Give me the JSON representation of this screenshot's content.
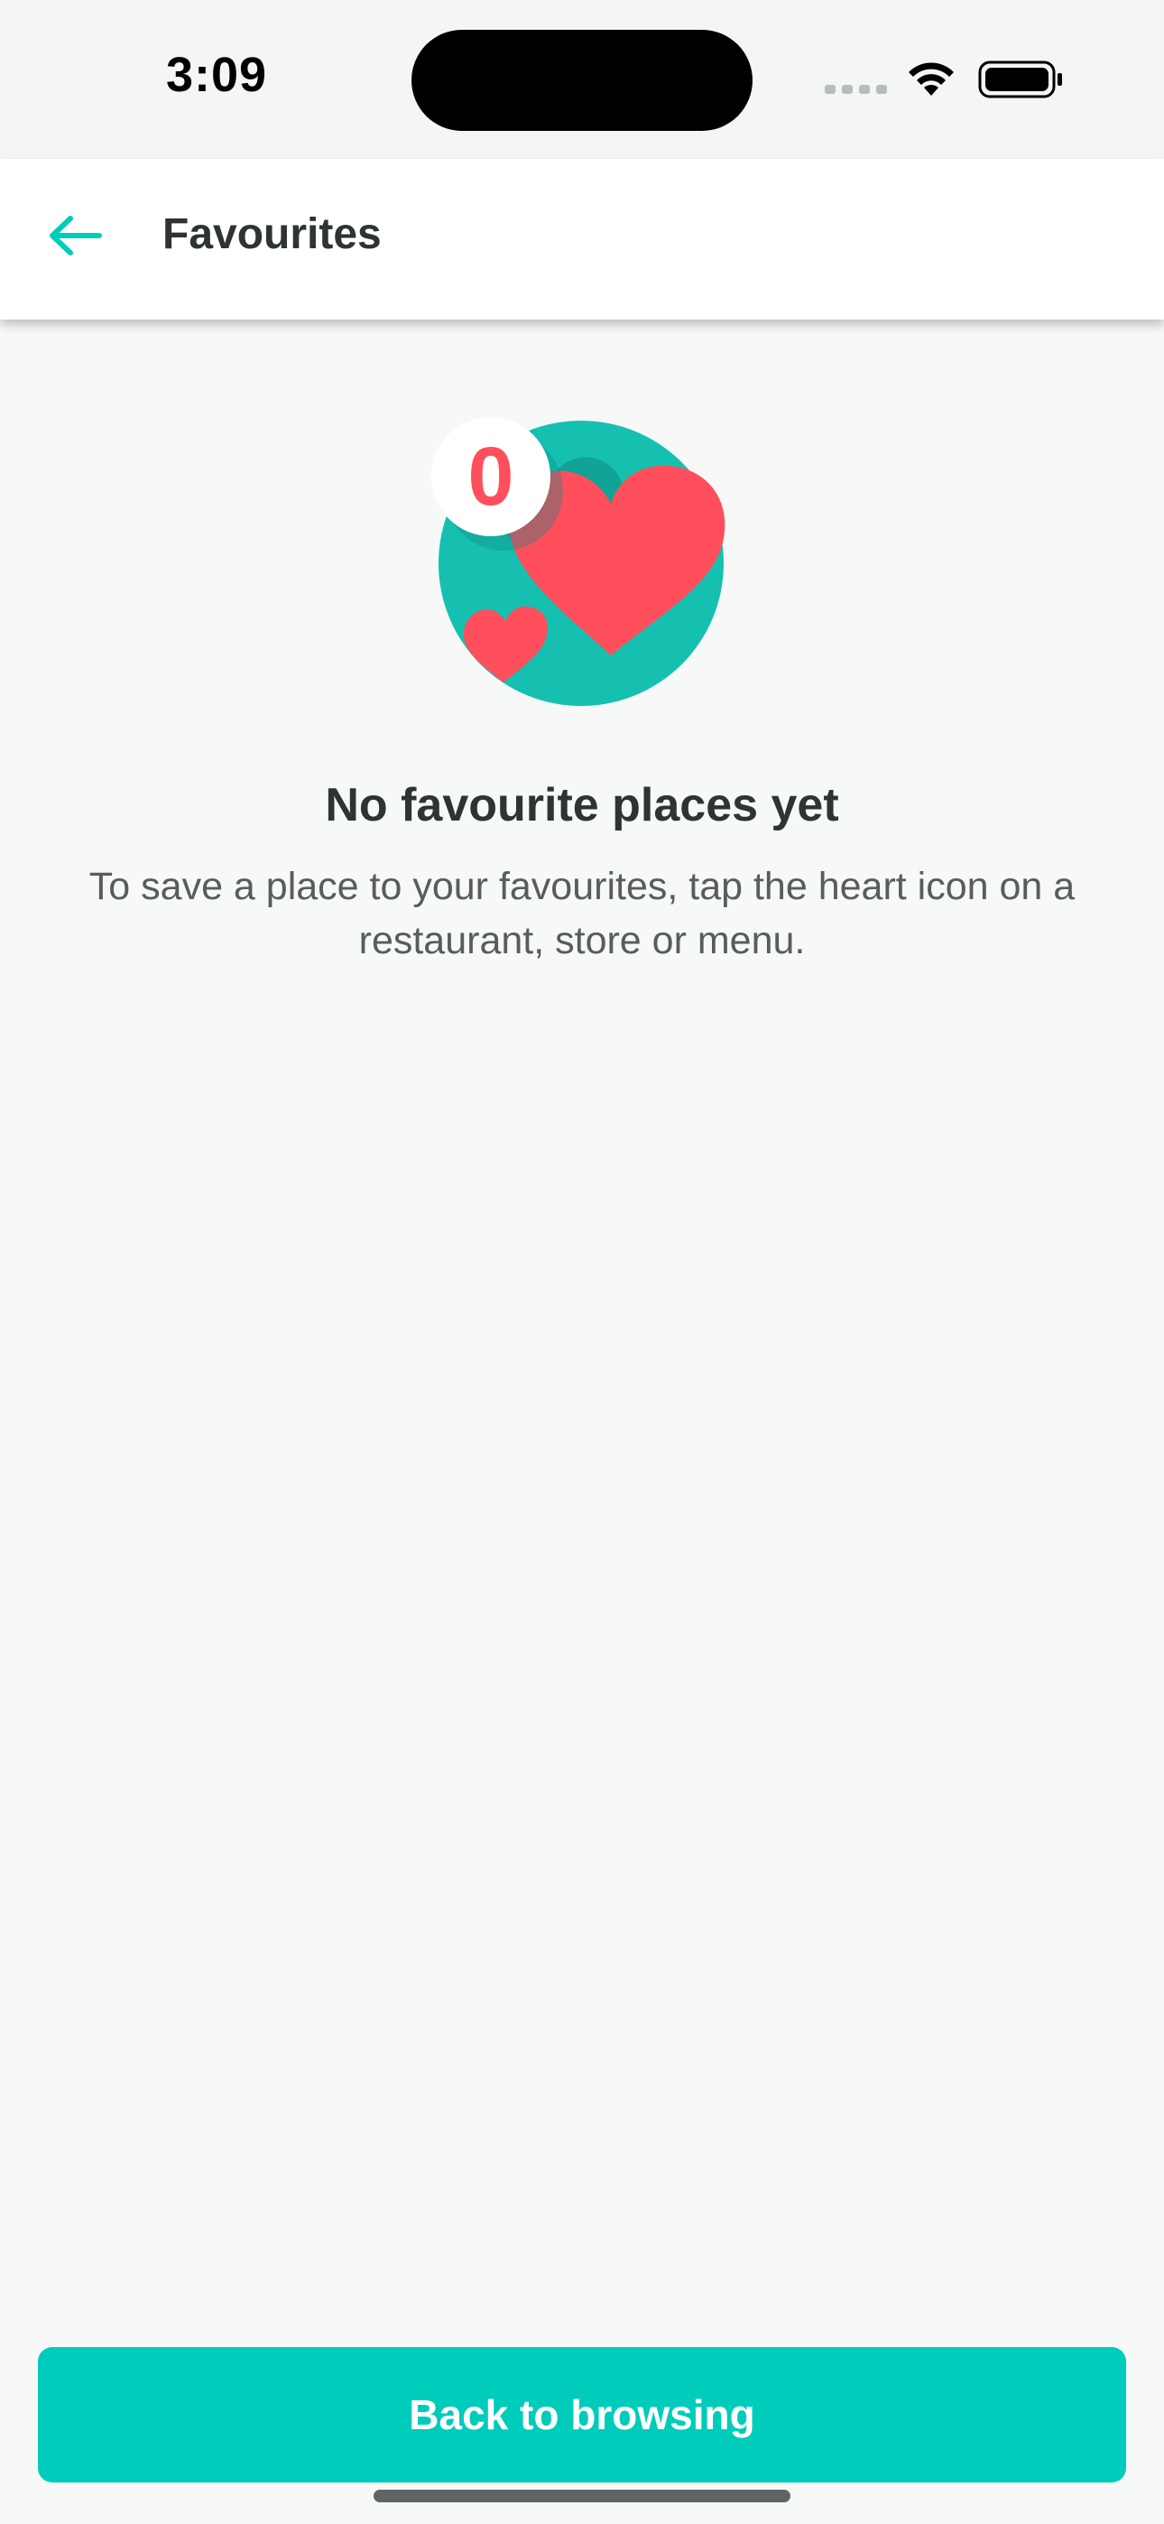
{
  "status_bar": {
    "time": "3:09",
    "icons": [
      "cellular-signal-icon",
      "wifi-icon",
      "battery-icon"
    ]
  },
  "header": {
    "title": "Favourites",
    "back_icon": "arrow-left-icon"
  },
  "empty_state": {
    "badge_count": "0",
    "illustration_icon": "hearts-illustration-icon",
    "title": "No favourite places yet",
    "description": "To save a place to your favourites, tap the heart icon on a restaurant, store or menu."
  },
  "footer": {
    "button_label": "Back to browsing"
  },
  "colors": {
    "accent": "#00ccbc",
    "heart": "#ff4f5c",
    "background": "#f7f8f8",
    "text_primary": "#2e3333",
    "text_secondary": "#585c5c"
  }
}
